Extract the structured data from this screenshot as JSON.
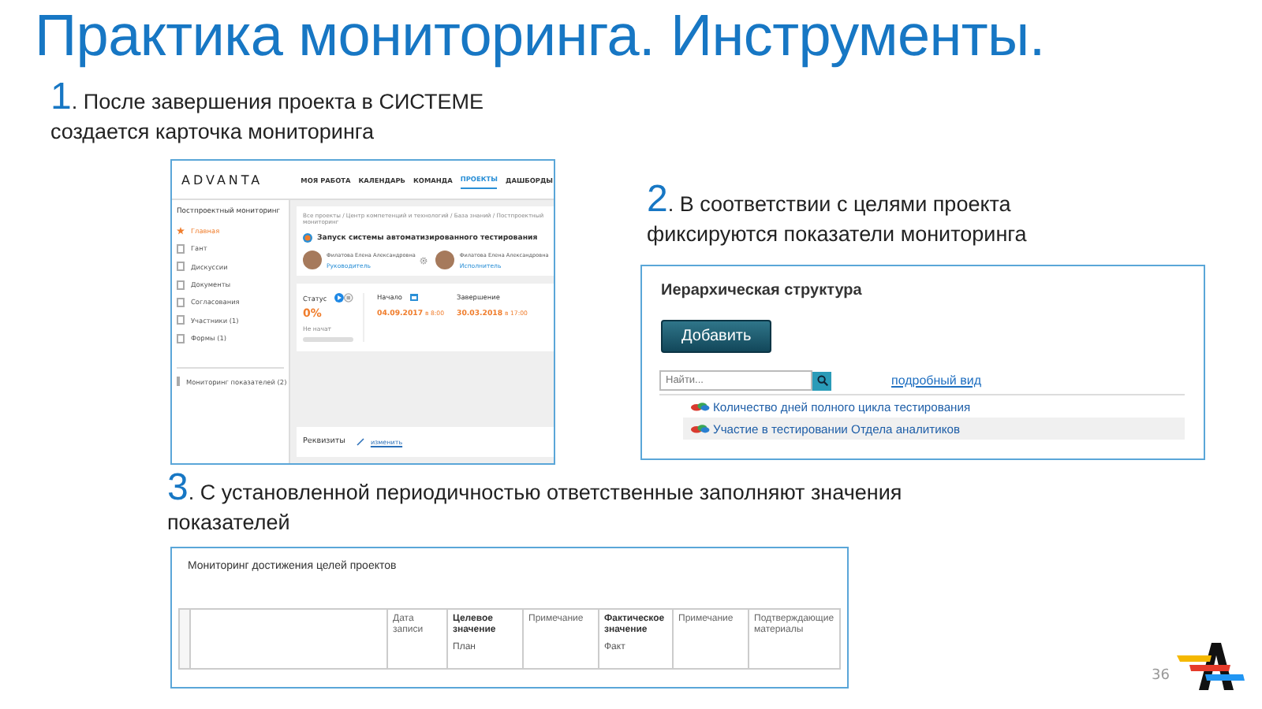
{
  "title": "Практика мониторинга. Инструменты.",
  "steps": [
    {
      "number": "1",
      "text": ". После завершения проекта в СИСТЕМЕ создается карточка мониторинга"
    },
    {
      "number": "2",
      "text": ". В соответствии с целями проекта фиксируются показатели мониторинга"
    },
    {
      "number": "3",
      "text": ". С установленной периодичностью ответственные заполняют значения показателей"
    }
  ],
  "project_card": {
    "logo": "ADVANTA",
    "nav": [
      {
        "label": "МОЯ РАБОТА",
        "selected": false
      },
      {
        "label": "КАЛЕНДАРЬ",
        "selected": false
      },
      {
        "label": "КОМАНДА",
        "selected": false
      },
      {
        "label": "ПРОЕКТЫ",
        "selected": true
      },
      {
        "label": "ДАШБОРДЫ",
        "selected": false
      }
    ],
    "sidebar": {
      "title": "Постпроектный мониторинг",
      "items": [
        {
          "label": "Главная",
          "selected": true
        },
        {
          "label": "Гант",
          "selected": false
        },
        {
          "label": "Дискуссии",
          "selected": false
        },
        {
          "label": "Документы",
          "selected": false
        },
        {
          "label": "Согласования",
          "selected": false
        },
        {
          "label": "Участники (1)",
          "selected": false
        },
        {
          "label": "Формы (1)",
          "selected": false
        }
      ],
      "footer_item": "Мониторинг показателей (2)"
    },
    "breadcrumb": "Все проекты / Центр компетенций и технологий / База знаний / Постпроектный мониторинг",
    "project_title": "Запуск системы автоматизированного тестирования",
    "people": [
      {
        "name": "Филатова Елена Александровна",
        "role": "Руководитель"
      },
      {
        "name": "Филатова Елена Александровна",
        "role": "Исполнитель"
      }
    ],
    "status": {
      "label": "Статус",
      "value": "0%",
      "note": "Не начат",
      "level": 0
    },
    "start": {
      "label": "Начало",
      "date": "04.09.2017",
      "time": "в 8:00"
    },
    "end": {
      "label": "Завершение",
      "date": "30.03.2018",
      "time": "в 17:00"
    },
    "requisites": "Реквизиты",
    "edit_link": "изменить"
  },
  "hierarchy": {
    "title": "Иерархическая структура",
    "add_button": "Добавить",
    "search": {
      "placeholder": "Найти..."
    },
    "detail_link": "подробный вид",
    "items": [
      {
        "label": "Количество дней полного цикла тестирования",
        "selected": false
      },
      {
        "label": "Участие в тестировании Отдела аналитиков",
        "selected": true
      }
    ]
  },
  "monitoring": {
    "title": "Мониторинг достижения целей проектов",
    "columns": [
      {
        "label": "Дата записи",
        "bold": false
      },
      {
        "label": "Целевое значение",
        "bold": true,
        "sublabel": "План"
      },
      {
        "label": "Примечание",
        "bold": false
      },
      {
        "label": "Фактическое значение",
        "bold": true,
        "sublabel": "Факт"
      },
      {
        "label": "Примечание",
        "bold": false
      },
      {
        "label": "Подтверждающие материалы",
        "bold": false
      }
    ]
  },
  "page_number": "36"
}
